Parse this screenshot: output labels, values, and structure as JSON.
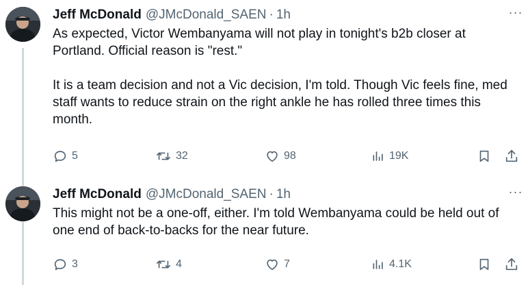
{
  "tweets": [
    {
      "author": {
        "name": "Jeff McDonald",
        "handle": "@JMcDonald_SAEN",
        "time": "1h"
      },
      "paragraphs": [
        "As expected, Victor Wembanyama will not play in tonight's b2b closer at Portland. Official reason is \"rest.\"",
        "It is a team decision and not a Vic decision, I'm told. Though Vic feels fine, med staff wants to reduce strain on the right ankle he has rolled three times this month."
      ],
      "metrics": {
        "replies": "5",
        "reposts": "32",
        "likes": "98",
        "views": "19K"
      },
      "icons": {
        "reply": "reply-icon",
        "repost": "repost-icon",
        "like": "heart-icon",
        "views": "views-icon",
        "bookmark": "bookmark-icon",
        "share": "share-icon",
        "more": "more-icon"
      }
    },
    {
      "author": {
        "name": "Jeff McDonald",
        "handle": "@JMcDonald_SAEN",
        "time": "1h"
      },
      "paragraphs": [
        "This might not be a one-off, either. I'm told Wembanyama could be held out of one end of back-to-backs for the near future."
      ],
      "metrics": {
        "replies": "3",
        "reposts": "4",
        "likes": "7",
        "views": "4.1K"
      },
      "icons": {
        "reply": "reply-icon",
        "repost": "repost-icon",
        "like": "heart-icon",
        "views": "views-icon",
        "bookmark": "bookmark-icon",
        "share": "share-icon",
        "more": "more-icon"
      }
    }
  ],
  "more_glyph": "···",
  "dot_separator": "·",
  "colors": {
    "text": "#0f1419",
    "secondary": "#536471",
    "thread_line": "#cfd9de",
    "background": "#ffffff"
  }
}
